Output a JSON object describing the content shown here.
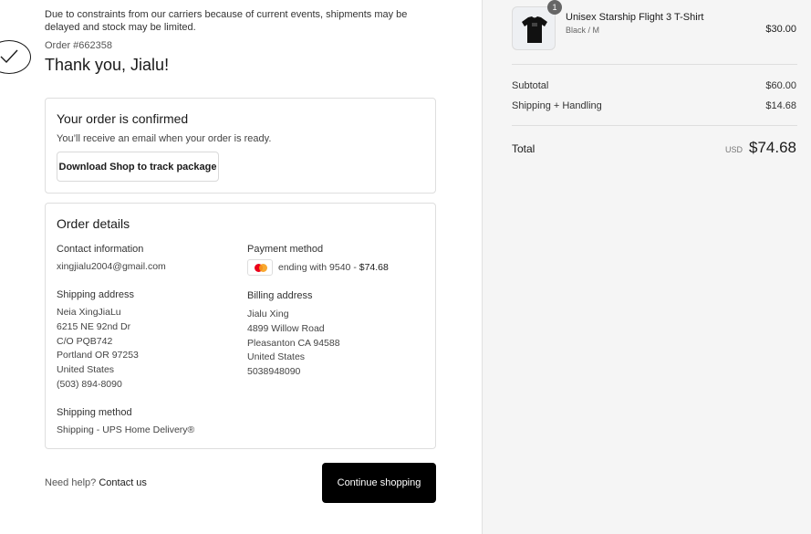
{
  "notice": "Due to constraints from our carriers because of current events, shipments may be delayed and stock may be limited.",
  "order": {
    "number": "Order #662358",
    "thanks": "Thank you, Jialu!"
  },
  "confirmation": {
    "title": "Your order is confirmed",
    "text": "You’ll receive an email when your order is ready.",
    "shop_button": "Download Shop to track package"
  },
  "details": {
    "title": "Order details",
    "contact_label": "Contact information",
    "contact_email": "xingjialu2004@gmail.com",
    "payment_label": "Payment method",
    "payment_text": "ending with 9540 - ",
    "payment_amount": "$74.68",
    "shipping_address_label": "Shipping address",
    "shipping_address": [
      "Neia XingJiaLu",
      "6215 NE 92nd Dr",
      "C/O PQB742",
      "Portland OR 97253",
      "United States",
      "(503) 894-8090"
    ],
    "billing_address_label": "Billing address",
    "billing_address": [
      "Jialu Xing",
      "4899 Willow Road",
      "Pleasanton CA 94588",
      "United States",
      "5038948090"
    ],
    "shipping_method_label": "Shipping method",
    "shipping_method": "Shipping - UPS Home Delivery®"
  },
  "footer": {
    "help_text": "Need help?",
    "contact_link": "Contact us",
    "continue_button": "Continue shopping"
  },
  "summary": {
    "product": {
      "name": "Unisex Starship Flight 3 T-Shirt",
      "variant": "Black / M",
      "price": "$30.00",
      "quantity": "1"
    },
    "subtotal_label": "Subtotal",
    "subtotal": "$60.00",
    "shipping_label": "Shipping + Handling",
    "shipping": "$14.68",
    "total_label": "Total",
    "currency": "USD",
    "total": "$74.68"
  },
  "icons": {
    "check": "check-icon",
    "card": "mastercard-icon"
  },
  "colors": {
    "primary_button": "#000000",
    "summary_background": "#f5f5f5"
  }
}
